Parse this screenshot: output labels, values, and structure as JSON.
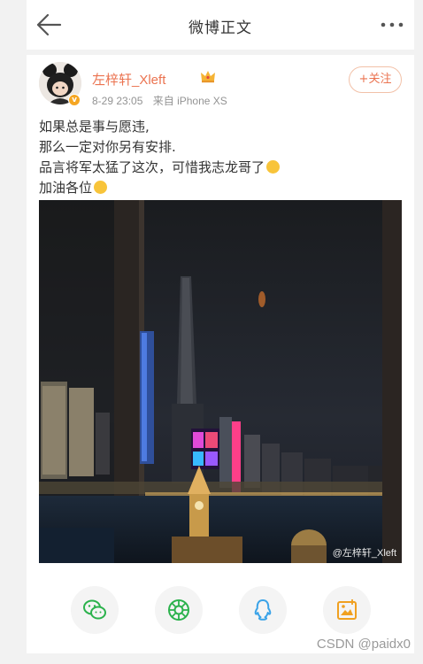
{
  "header": {
    "title": "微博正文",
    "back_icon": "arrow-left-icon",
    "more_icon": "more-dots-icon"
  },
  "post": {
    "username": "左梓轩_Xleft",
    "verified_icon": "verified-badge-icon",
    "crown_icon": "crown-icon",
    "time": "8-29 23:05",
    "source": "来自 iPhone XS",
    "follow_label": "+关注",
    "text_lines": [
      "如果总是事与愿违,",
      "那么一定对你另有安排.",
      "品言将军太猛了这次，可惜我志龙哥了",
      "加油各位"
    ],
    "image_watermark": "@左梓轩_Xleft"
  },
  "share": {
    "buttons": [
      "wechat-icon",
      "moments-icon",
      "qq-icon",
      "save-image-icon"
    ],
    "colors": [
      "#2bb24c",
      "#2bb24c",
      "#3aa3e8",
      "#f0a020"
    ]
  },
  "watermark": "CSDN @paidx0",
  "colors": {
    "accent": "#eb7350",
    "text": "#333333",
    "meta": "#939393",
    "background": "#f2f2f2"
  }
}
